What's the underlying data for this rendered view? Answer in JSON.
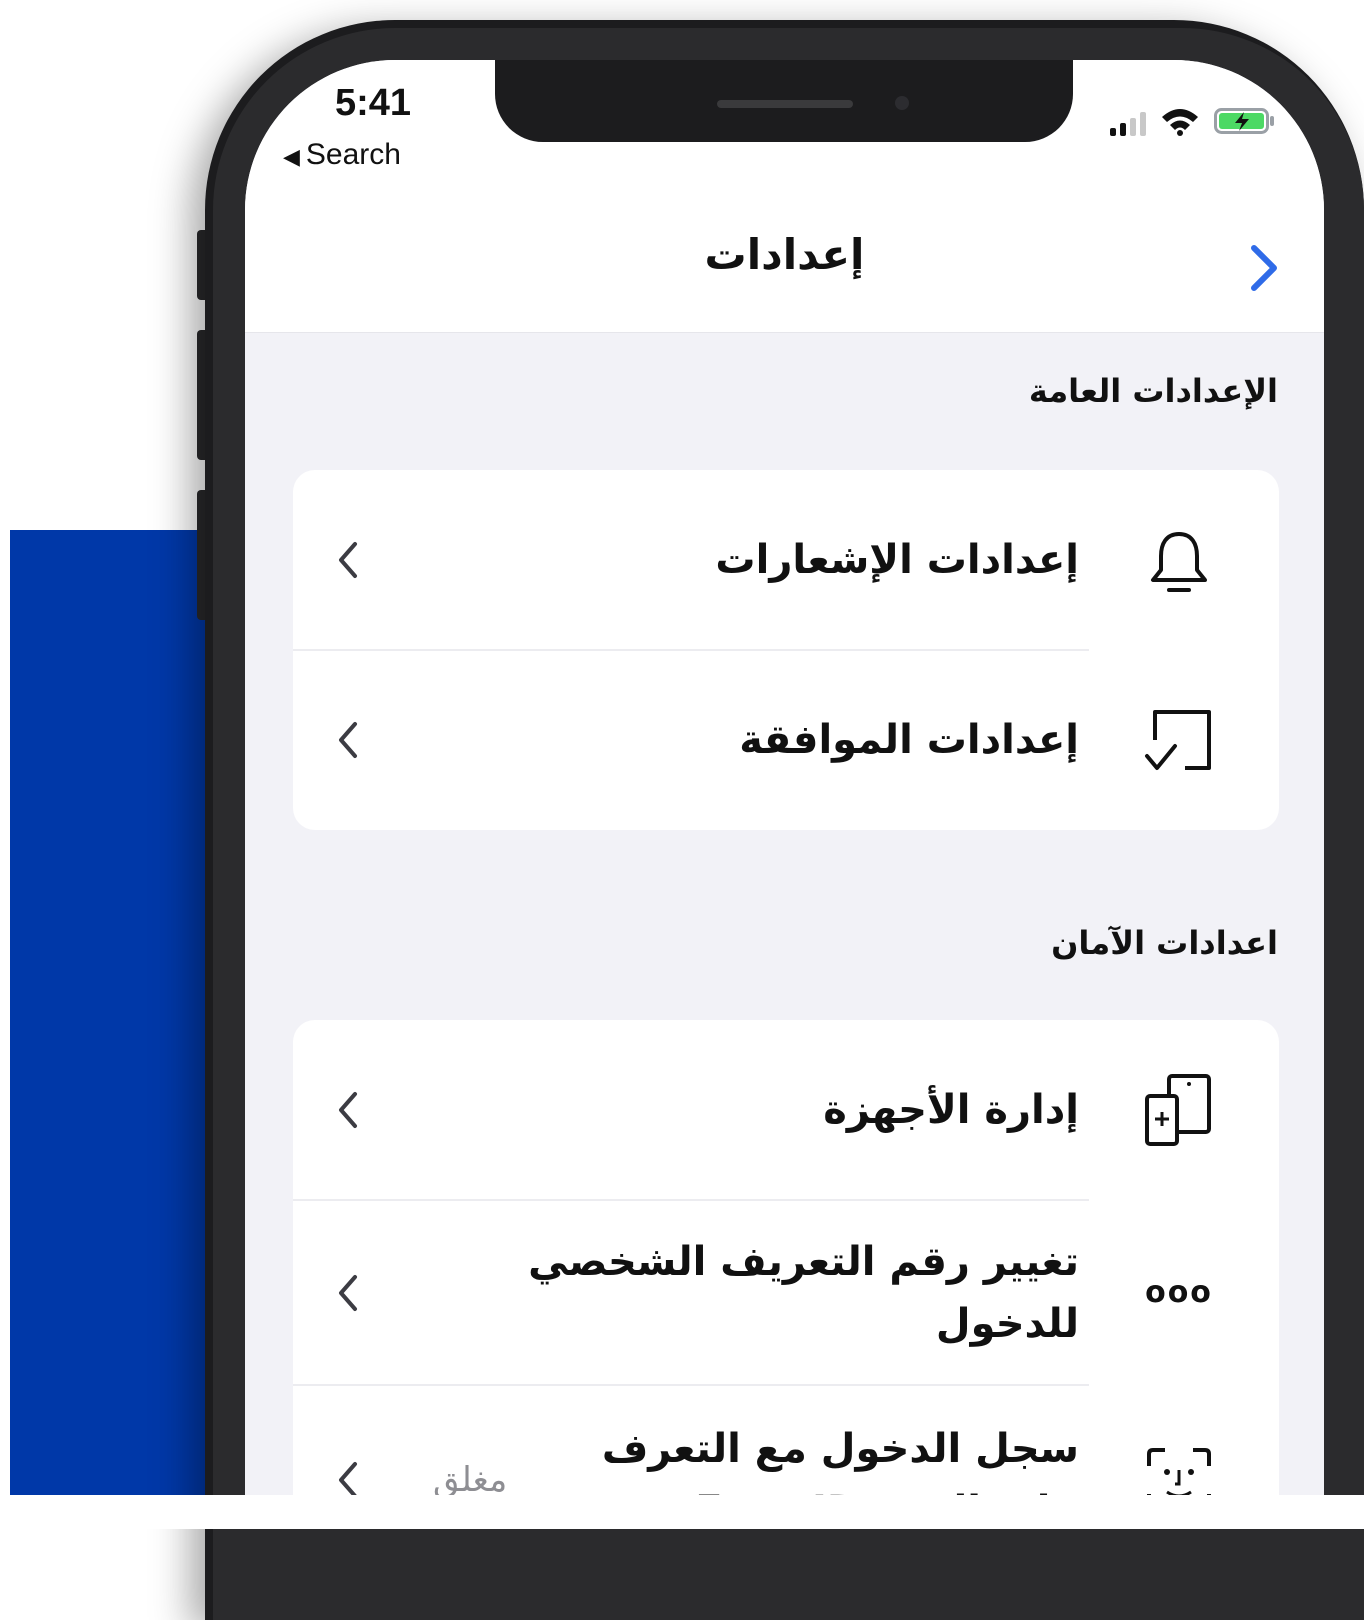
{
  "status_bar": {
    "time": "5:41",
    "back_label": "Search",
    "back_arrow": "◀"
  },
  "nav": {
    "title": "إعدادات",
    "back_icon": "chevron-right-icon",
    "accent_color": "#2F6BE8"
  },
  "sections": [
    {
      "header": "الإعدادات العامة",
      "items": [
        {
          "label": "إعدادات الإشعارات",
          "icon": "bell-icon"
        },
        {
          "label": "إعدادات الموافقة",
          "icon": "consent-check-icon"
        }
      ]
    },
    {
      "header": "اعدادات الآمان",
      "items": [
        {
          "label": "إدارة الأجهزة",
          "icon": "devices-icon"
        },
        {
          "label": "تغيير رقم التعريف الشخصي للدخول",
          "icon": "pin-dots-icon",
          "icon_text": "ooo"
        },
        {
          "label": "سجل الدخول مع التعرف على الوجه Face ID",
          "icon": "face-id-icon",
          "value": "مغلق"
        }
      ]
    }
  ],
  "colors": {
    "brand_blue": "#0038A8",
    "background": "#F2F2F7"
  }
}
